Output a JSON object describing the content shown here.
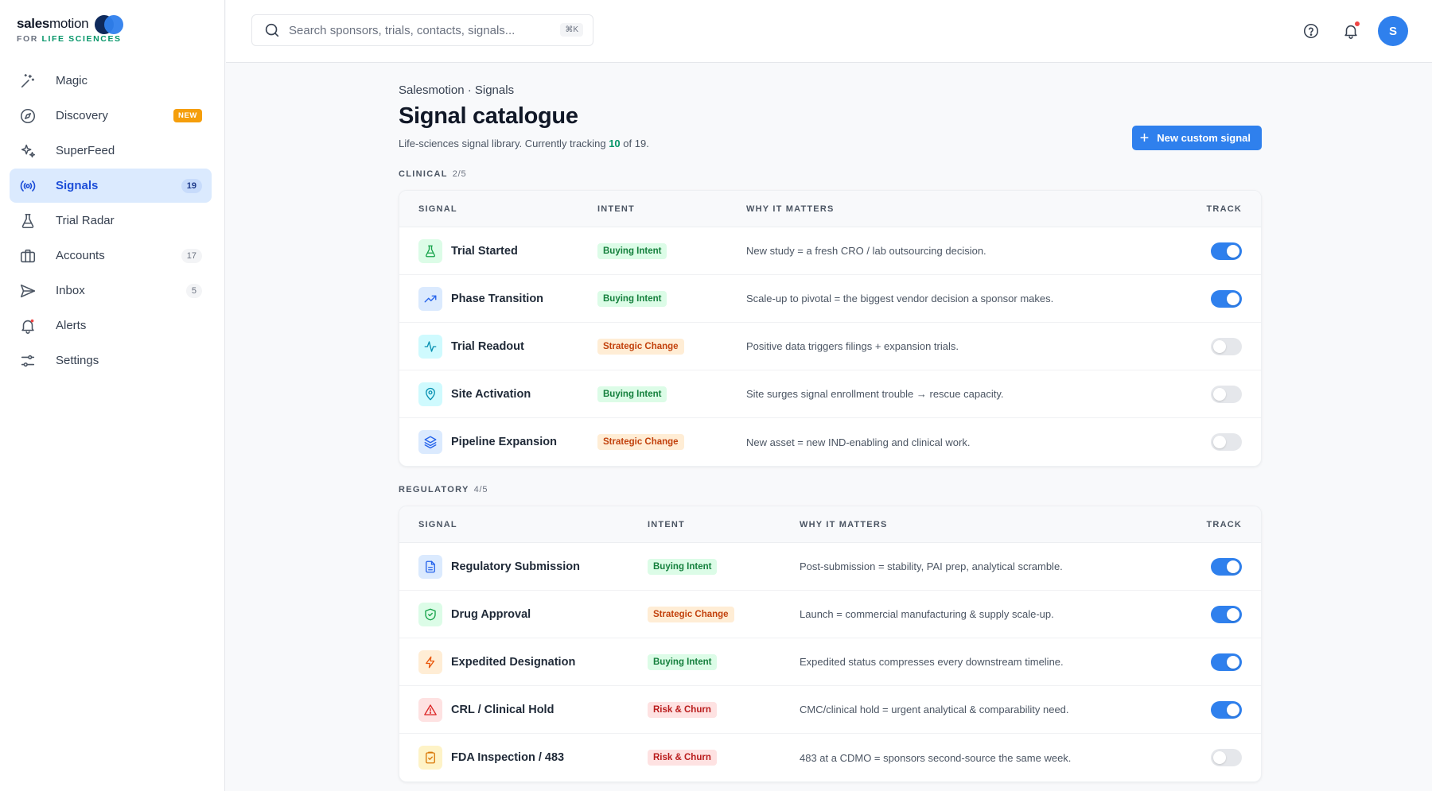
{
  "app": {
    "brand_part1": "sales",
    "brand_part2": "motion",
    "brand_sub_prefix": "FOR",
    "brand_sub_highlight": "LIFE SCIENCES"
  },
  "sidebar": {
    "items": [
      {
        "label": "Magic",
        "icon": "sparkle-wand-icon"
      },
      {
        "label": "Discovery",
        "icon": "compass-icon",
        "tag": "NEW"
      },
      {
        "label": "SuperFeed",
        "icon": "sparkles-icon"
      },
      {
        "label": "Signals",
        "icon": "broadcast-icon",
        "badge": "19",
        "active": true
      },
      {
        "label": "Trial Radar",
        "icon": "flask-icon"
      },
      {
        "label": "Accounts",
        "icon": "briefcase-icon",
        "badge": "17"
      },
      {
        "label": "Inbox",
        "icon": "send-icon",
        "badge": "5"
      },
      {
        "label": "Alerts",
        "icon": "bell-alert-icon"
      },
      {
        "label": "Settings",
        "icon": "sliders-icon"
      }
    ]
  },
  "topbar": {
    "search_placeholder": "Search sponsors, trials, contacts, signals...",
    "search_shortcut": "⌘K",
    "avatar_initial": "S"
  },
  "main": {
    "breadcrumb": "Salesmotion · Signals",
    "title": "Signal catalogue",
    "subtitle_prefix": "Life-sciences signal library. Currently tracking ",
    "tracking_count": "10",
    "subtitle_suffix": " of 19.",
    "new_button_label": "New custom signal",
    "columns": {
      "signal": "SIGNAL",
      "intent": "INTENT",
      "why": "WHY IT MATTERS",
      "track": "TRACK"
    },
    "sections": [
      {
        "name": "CLINICAL",
        "count": "2/5",
        "rows": [
          {
            "name": "Trial Started",
            "icon": "flask-icon",
            "intent": "Buying Intent",
            "intent_kind": "buy",
            "why": "New study = a fresh CRO / lab outsourcing decision.",
            "tracked": true
          },
          {
            "name": "Phase Transition",
            "icon": "trending-up-icon",
            "intent": "Buying Intent",
            "intent_kind": "buy",
            "why": "Scale-up to pivotal = the biggest vendor decision a sponsor makes.",
            "tracked": true
          },
          {
            "name": "Trial Readout",
            "icon": "pulse-icon",
            "intent": "Strategic Change",
            "intent_kind": "strat",
            "why": "Positive data triggers filings + expansion trials.",
            "tracked": false
          },
          {
            "name": "Site Activation",
            "icon": "map-pin-icon",
            "intent": "Buying Intent",
            "intent_kind": "buy",
            "why": "Site surges signal enrollment trouble → rescue capacity.",
            "tracked": false
          },
          {
            "name": "Pipeline Expansion",
            "icon": "layers-icon",
            "intent": "Strategic Change",
            "intent_kind": "strat",
            "why": "New asset = new IND-enabling and clinical work.",
            "tracked": false
          }
        ]
      },
      {
        "name": "REGULATORY",
        "count": "4/5",
        "rows": [
          {
            "name": "Regulatory Submission",
            "icon": "document-icon",
            "intent": "Buying Intent",
            "intent_kind": "buy",
            "why": "Post-submission = stability, PAI prep, analytical scramble.",
            "tracked": true
          },
          {
            "name": "Drug Approval",
            "icon": "shield-check-icon",
            "intent": "Strategic Change",
            "intent_kind": "strat",
            "why": "Launch = commercial manufacturing & supply scale-up.",
            "tracked": true
          },
          {
            "name": "Expedited Designation",
            "icon": "lightning-icon",
            "intent": "Buying Intent",
            "intent_kind": "buy",
            "why": "Expedited status compresses every downstream timeline.",
            "tracked": true
          },
          {
            "name": "CRL / Clinical Hold",
            "icon": "warning-triangle-icon",
            "intent": "Risk & Churn",
            "intent_kind": "risk",
            "why": "CMC/clinical hold = urgent analytical & comparability need.",
            "tracked": true
          },
          {
            "name": "FDA Inspection / 483",
            "icon": "clipboard-check-icon",
            "intent": "Risk & Churn",
            "intent_kind": "risk",
            "why": "483 at a CDMO = sponsors second-source the same week.",
            "tracked": false
          }
        ]
      }
    ]
  }
}
